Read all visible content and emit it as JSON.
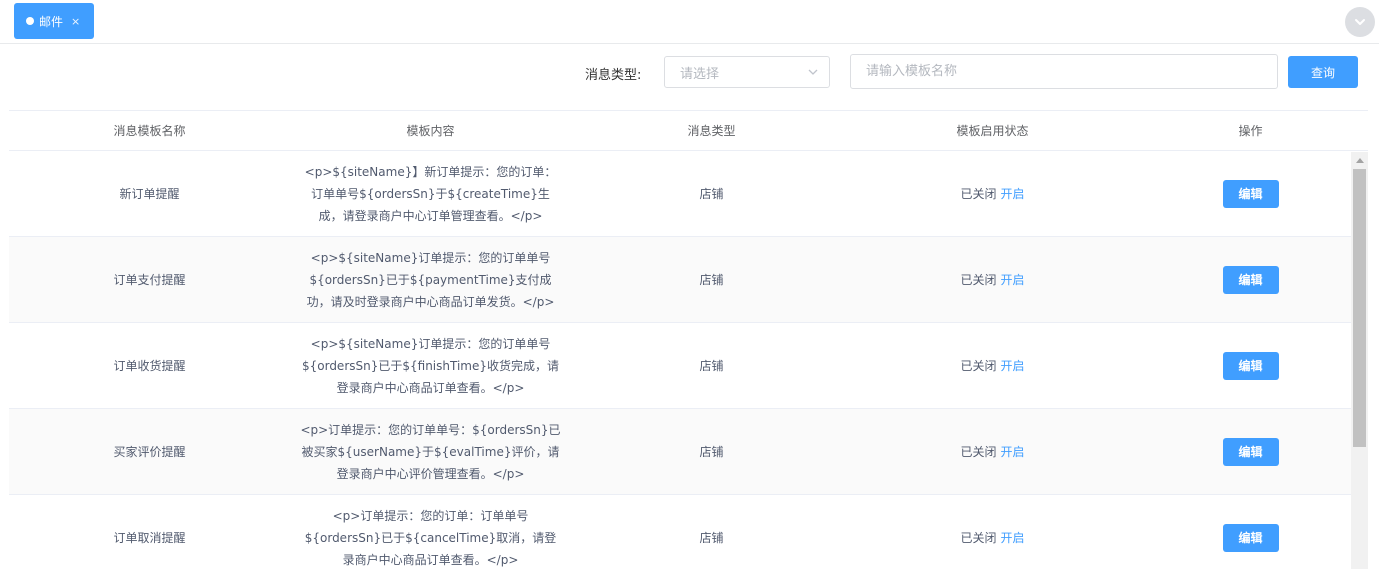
{
  "tabs": [
    {
      "label": "邮件",
      "close": "×"
    }
  ],
  "filter": {
    "type_label": "消息类型:",
    "type_placeholder": "请选择",
    "name_placeholder": "请输入模板名称",
    "query_label": "查询"
  },
  "table": {
    "headers": [
      "消息模板名称",
      "模板内容",
      "消息类型",
      "模板启用状态",
      "操作"
    ],
    "rows": [
      {
        "name": "新订单提醒",
        "content": "<p>${siteName}】新订单提示：您的订单：订单单号${ordersSn}于${createTime}生成，请登录商户中心订单管理查看。</p>",
        "type": "店铺",
        "status": "已关闭",
        "toggle": "开启",
        "action": "编辑"
      },
      {
        "name": "订单支付提醒",
        "content": "<p>${siteName}订单提示：您的订单单号${ordersSn}已于${paymentTime}支付成功，请及时登录商户中心商品订单发货。</p>",
        "type": "店铺",
        "status": "已关闭",
        "toggle": "开启",
        "action": "编辑"
      },
      {
        "name": "订单收货提醒",
        "content": "<p>${siteName}订单提示：您的订单单号${ordersSn}已于${finishTime}收货完成，请登录商户中心商品订单查看。</p>",
        "type": "店铺",
        "status": "已关闭",
        "toggle": "开启",
        "action": "编辑"
      },
      {
        "name": "买家评价提醒",
        "content": "<p>订单提示：您的订单单号：${ordersSn}已被买家${userName}于${evalTime}评价，请登录商户中心评价管理查看。</p>",
        "type": "店铺",
        "status": "已关闭",
        "toggle": "开启",
        "action": "编辑"
      },
      {
        "name": "订单取消提醒",
        "content": "<p>订单提示：您的订单：订单单号${ordersSn}已于${cancelTime}取消，请登录商户中心商品订单查看。</p>",
        "type": "店铺",
        "status": "已关闭",
        "toggle": "开启",
        "action": "编辑"
      }
    ]
  },
  "colors": {
    "primary": "#409eff",
    "border": "#ebeef5",
    "text": "#515a6e"
  }
}
